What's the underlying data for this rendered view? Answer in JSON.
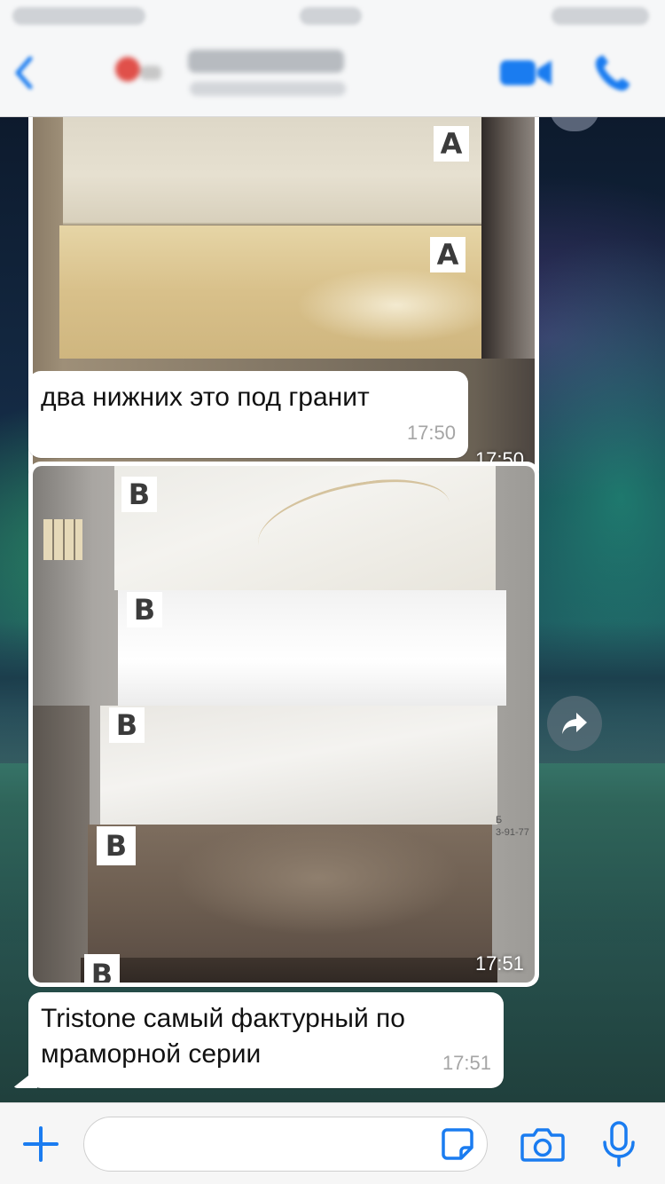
{
  "colors": {
    "accent": "#1a7cf0",
    "bubble": "#ffffff",
    "timestamp": "#a5a5a5"
  },
  "header": {
    "back_icon": "chevron-left-icon",
    "video_icon": "video-camera-icon",
    "phone_icon": "phone-icon"
  },
  "messages": [
    {
      "type": "image",
      "time": "17:50",
      "labels": [
        "A",
        "A"
      ]
    },
    {
      "type": "text",
      "text": "два нижних это под гранит",
      "time": "17:50"
    },
    {
      "type": "image",
      "time": "17:51",
      "labels": [
        "B",
        "B",
        "B",
        "B",
        "B"
      ],
      "side_text": "Б\n3-91-77"
    },
    {
      "type": "text",
      "text_line1": "Tristone самый фактурный по",
      "text_line2": "мраморной серии",
      "time": "17:51"
    }
  ],
  "input": {
    "placeholder": "",
    "plus_icon": "plus-icon",
    "sticker_icon": "sticker-icon",
    "camera_icon": "camera-icon",
    "mic_icon": "microphone-icon"
  },
  "forward_icon": "forward-arrow-icon"
}
